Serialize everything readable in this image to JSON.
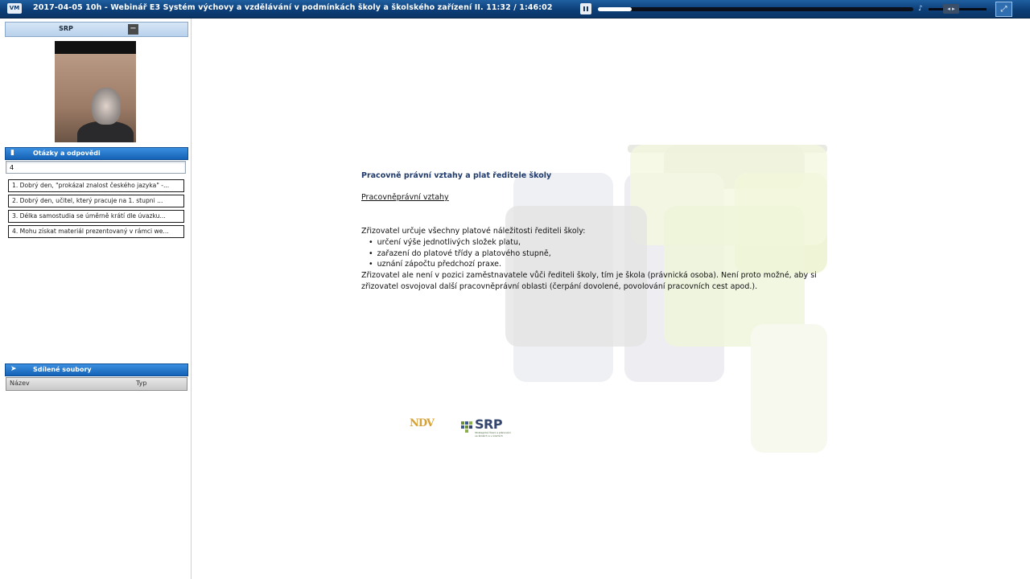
{
  "app": {
    "title": "2017-04-05 10h - Webinář E3 Systém výchovy a vzdělávání v podmínkách školy a školského zařízení II. 11:32 / 1:46:02",
    "logo_text": "VM"
  },
  "player": {
    "pause_icon": "pause-icon",
    "progress_fraction": 0.108,
    "volume_icon": "speaker-icon",
    "volume_knob_glyph": "◂ ▸",
    "fullscreen_icon": "fullscreen-icon",
    "fullscreen_glyph": "⤢"
  },
  "presenter_panel": {
    "title": "SRP",
    "minimize_glyph": "−"
  },
  "qa_panel": {
    "title": "Otázky a odpovědi",
    "icon": "speech-bubble-icon",
    "input_value": "4",
    "questions": [
      "1. Dobrý den, \"prokázal znalost českého jazyka\" -...",
      "2. Dobrý den, učitel, který pracuje na 1. stupni ...",
      "3. Délka samostudia se úměrně krátí dle úvazku...",
      "4. Mohu získat materiál prezentovaný v rámci we..."
    ]
  },
  "files_panel": {
    "title": "Sdílené soubory",
    "icon": "share-icon",
    "columns": [
      "Název",
      "Typ"
    ]
  },
  "slide": {
    "title": "Pracovně právní vztahy a plat ředitele školy",
    "subtitle": "Pracovněprávní vztahy",
    "intro": "Zřizovatel určuje všechny platové náležitosti řediteli školy:",
    "bullets": [
      "určení výše jednotlivých složek platu,",
      "zařazení do platové třídy a platového stupně,",
      "uznání zápočtu předchozí praxe."
    ],
    "paragraph": "Zřizovatel ale není v pozici zaměstnavatele vůči řediteli školy, tím je škola (právnická osoba). Není proto možné, aby si zřizovatel osvojoval další pracovněprávní oblasti (čerpání dovolené, povolování pracovních cest apod.).",
    "logo_ndv": "NDV",
    "logo_srp": "SRP",
    "logo_srp_sub": "Strategické řízení a plánování ve školách a v územích"
  },
  "colors": {
    "topbar": "#0d3f78",
    "panel_header": "#1562b5",
    "slide_title": "#1f3a6b"
  }
}
